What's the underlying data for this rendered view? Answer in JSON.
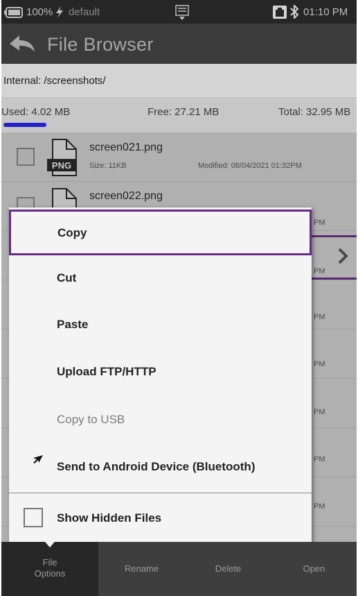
{
  "status_bar": {
    "battery": "100%",
    "profile": "default",
    "time": "01:10 PM"
  },
  "header": {
    "title": "File Browser"
  },
  "location": {
    "path": "Internal: /screenshots/"
  },
  "storage": {
    "used": "Used: 4.02 MB",
    "free": "Free: 27.21 MB",
    "total": "Total: 32.95 MB",
    "used_fraction": 0.122
  },
  "files": [
    {
      "name": "screen021.png",
      "size": "Size: 11KB",
      "modified": "Modified: 08/04/2021 01:32PM",
      "icon_label": "PNG"
    },
    {
      "name": "screen022.png"
    }
  ],
  "partial_row_suffix": "PM",
  "menu": {
    "items": [
      {
        "label": "Copy"
      },
      {
        "label": "Cut"
      },
      {
        "label": "Paste"
      },
      {
        "label": "Upload FTP/HTTP"
      },
      {
        "label": "Copy to USB"
      },
      {
        "label": "Send to Android Device (Bluetooth)"
      }
    ],
    "show_hidden_label": "Show Hidden Files"
  },
  "toolbar": {
    "file_options_line1": "File",
    "file_options_line2": "Options",
    "rename": "Rename",
    "delete": "Delete",
    "open": "Open"
  },
  "colors": {
    "accent": "#6a2a8a",
    "usage_bar": "#2424c8",
    "status_bar_bg": "#262626",
    "title_bar_bg": "#3b3b3b",
    "toolbar_bg": "#3e3e3e"
  }
}
